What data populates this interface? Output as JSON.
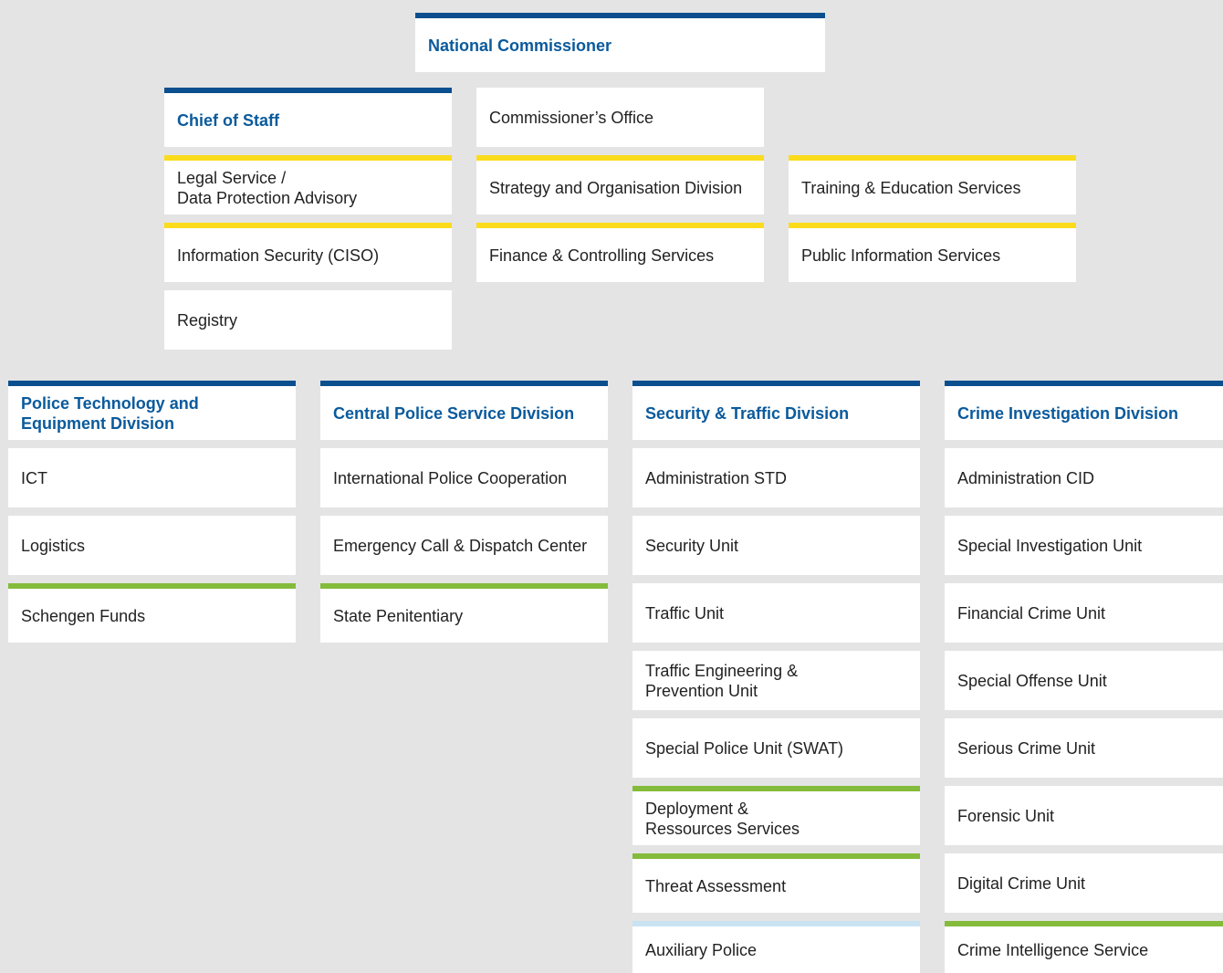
{
  "colors": {
    "background": "#e4e4e4",
    "box": "#ffffff",
    "heading_text": "#0a5a9c",
    "bar_blue": "#0b4f8f",
    "bar_yellow": "#fbdc1c",
    "bar_green": "#84bb3a",
    "bar_lightblue": "#c9e3f3"
  },
  "top": {
    "commissioner": "National Commissioner",
    "chief_of_staff": "Chief of Staff",
    "commissioners_office": "Commissioner’s Office",
    "legal_service": "Legal Service /\nData Protection Advisory",
    "info_security": "Information Security (CISO)",
    "registry": "Registry",
    "strategy": "Strategy and Organisation Division",
    "finance": "Finance & Controlling Services",
    "training": "Training & Education Services",
    "public_info": "Public Information Services"
  },
  "divisions": {
    "ptd": {
      "title": "Police Technology and\nEquipment Division",
      "units": [
        "ICT",
        "Logistics",
        "Schengen Funds"
      ]
    },
    "cps": {
      "title": "Central Police Service Division",
      "units": [
        "International Police Cooperation",
        "Emergency Call & Dispatch Center",
        "State Penitentiary"
      ]
    },
    "std": {
      "title": "Security & Traffic Division",
      "units": [
        "Administration STD",
        "Security Unit",
        "Traffic Unit",
        "Traffic Engineering &\nPrevention Unit",
        "Special Police Unit (SWAT)",
        "Deployment &\nRessources Services",
        "Threat Assessment",
        "Auxiliary Police"
      ]
    },
    "cid": {
      "title": "Crime Investigation Division",
      "units": [
        "Administration CID",
        "Special Investigation Unit",
        "Financial Crime Unit",
        "Special Offense Unit",
        "Serious Crime Unit",
        "Forensic Unit",
        "Digital Crime Unit",
        "Crime Intelligence Service"
      ]
    }
  }
}
